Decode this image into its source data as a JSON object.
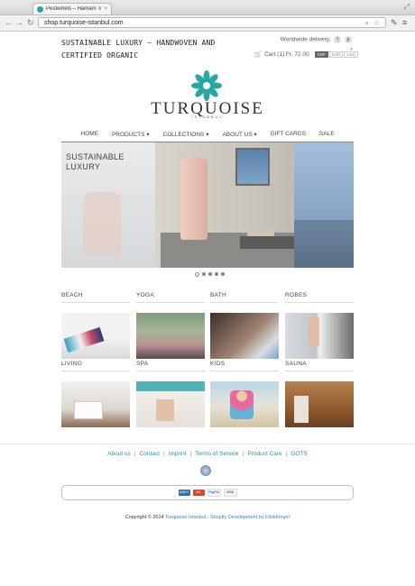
{
  "browser": {
    "tab_title": "Pestemels – Hamam Towe",
    "tab_close": "×",
    "url": "shop.turquoise-istanbul.com"
  },
  "header": {
    "tagline": "SUSTAINABLE LUXURY – HANDWOVEN AND CERTIFIED ORGANIC",
    "delivery": "Worldwide delivery.",
    "social": [
      {
        "icon": "facebook-icon",
        "glyph": "f"
      },
      {
        "icon": "pinterest-icon",
        "glyph": "p"
      }
    ],
    "cart_label": "Cart (1) Fr. 72.00",
    "currencies": [
      {
        "label": "CHF",
        "active": true
      },
      {
        "label": "EUR",
        "active": false
      },
      {
        "label": "USD",
        "active": false
      }
    ]
  },
  "logo": {
    "name": "TURQUOISE",
    "sub": "ISTANBUL",
    "mark_color": "#2aa6a6"
  },
  "nav": [
    "HOME",
    "PRODUCTS ▾",
    "COLLECTIONS ▾",
    "ABOUT US ▾",
    "GIFT CARDS",
    "SALE"
  ],
  "hero": {
    "text_line1": "SUSTAINABLE",
    "text_line2": "LUXURY",
    "slides": 5,
    "active_slide": 0
  },
  "categories": [
    {
      "label": "BEACH",
      "img": "beach"
    },
    {
      "label": "YOGA",
      "img": "yoga"
    },
    {
      "label": "BATH",
      "img": "bath"
    },
    {
      "label": "ROBES",
      "img": "robes"
    },
    {
      "label": "LIVING",
      "img": "living"
    },
    {
      "label": "SPA",
      "img": "spa"
    },
    {
      "label": "KIDS",
      "img": "kids"
    },
    {
      "label": "SAUNA",
      "img": "sauna"
    }
  ],
  "footer": {
    "links": [
      "About us",
      "Contact",
      "Imprint",
      "Terms of Service",
      "Product Care",
      "GOTS"
    ],
    "payments": [
      {
        "name": "AMEX",
        "color": "#2f6fb7"
      },
      {
        "name": "MC",
        "color": "#d9452a"
      },
      {
        "name": "PayPal",
        "color": "#253b80"
      },
      {
        "name": "VISA",
        "color": "#1a1f71"
      }
    ],
    "copyright_prefix": "Copyright © 2014",
    "copyright_link": "Turquoise Istanbul - Shopify Development by FlinkFinger"
  },
  "colors": {
    "accent": "#2a8fa8",
    "brand": "#2aa6a6"
  }
}
